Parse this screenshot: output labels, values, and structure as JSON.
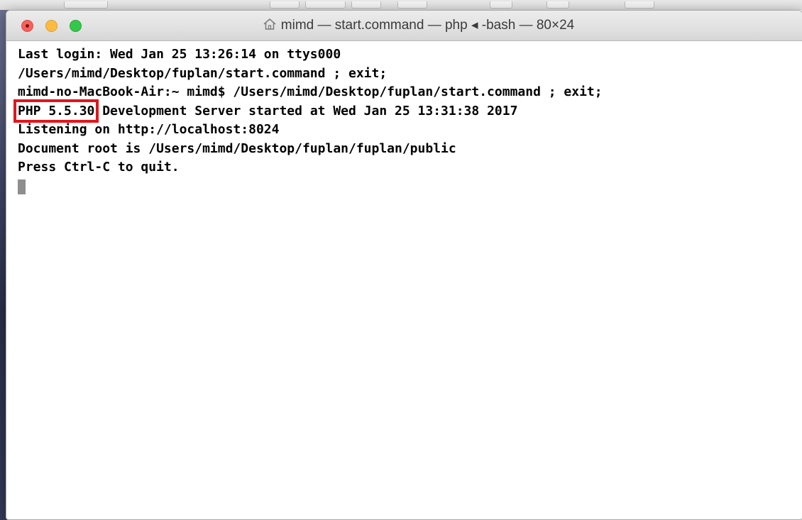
{
  "window": {
    "title": "mimd — start.command — php ◂ -bash — 80×24"
  },
  "terminal": {
    "lines": [
      "Last login: Wed Jan 25 13:26:14 on ttys000",
      "/Users/mimd/Desktop/fuplan/start.command ; exit;",
      "mimd-no-MacBook-Air:~ mimd$ /Users/mimd/Desktop/fuplan/start.command ; exit;",
      "Development Server started at Wed Jan 25 13:31:38 2017",
      "Listening on http://localhost:8024",
      "Document root is /Users/mimd/Desktop/fuplan/fuplan/public",
      "Press Ctrl-C to quit."
    ],
    "highlighted_prefix": "PHP 5.5.30",
    "highlight_color": "#e3151b"
  },
  "colors": {
    "close": "#fc605c",
    "minimize": "#fdbc40",
    "zoom": "#34c84a",
    "text": "#000000"
  },
  "icons": {
    "title_icon": "home-icon"
  }
}
